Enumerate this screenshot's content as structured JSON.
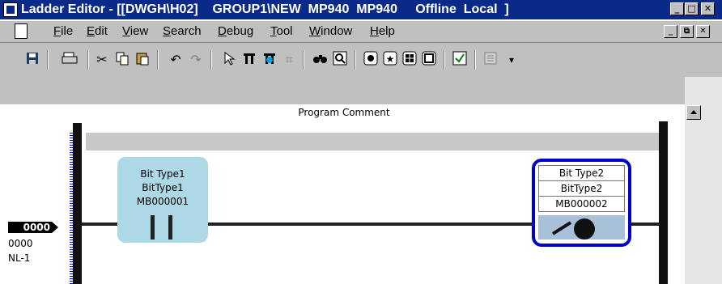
{
  "window": {
    "title": "Ladder Editor - [[DWGH\\H02]    GROUP1\\NEW  MP940  MP940     Offline  Local  ]"
  },
  "title_buttons": [
    "_",
    "□",
    "✕"
  ],
  "menu": {
    "items": [
      "File",
      "Edit",
      "View",
      "Search",
      "Debug",
      "Tool",
      "Window",
      "Help"
    ],
    "doc_buttons": [
      "_",
      "⧉",
      "✕"
    ]
  },
  "toolbar": {
    "icons": [
      "save-icon",
      "print-icon",
      "cut-icon",
      "copy-icon",
      "paste-icon",
      "undo-icon",
      "redo-icon",
      "pointer-icon",
      "contact-icon",
      "coil-icon",
      "function-icon",
      "find-icon",
      "zoom-icon",
      "box1-icon",
      "star-icon",
      "grid-icon",
      "window-icon",
      "check-icon",
      "doc-icon",
      "dropdown-icon"
    ]
  },
  "editor": {
    "program_comment": "Program Comment",
    "contact1": {
      "line1": "Bit Type1",
      "line2": "BitType1",
      "line3": "MB000001"
    },
    "coil1": {
      "line1": "Bit Type2",
      "line2": "BitType2",
      "line3": "MB000002"
    },
    "row": {
      "step": "0000",
      "step2": "0000",
      "nl": "NL-1"
    }
  }
}
